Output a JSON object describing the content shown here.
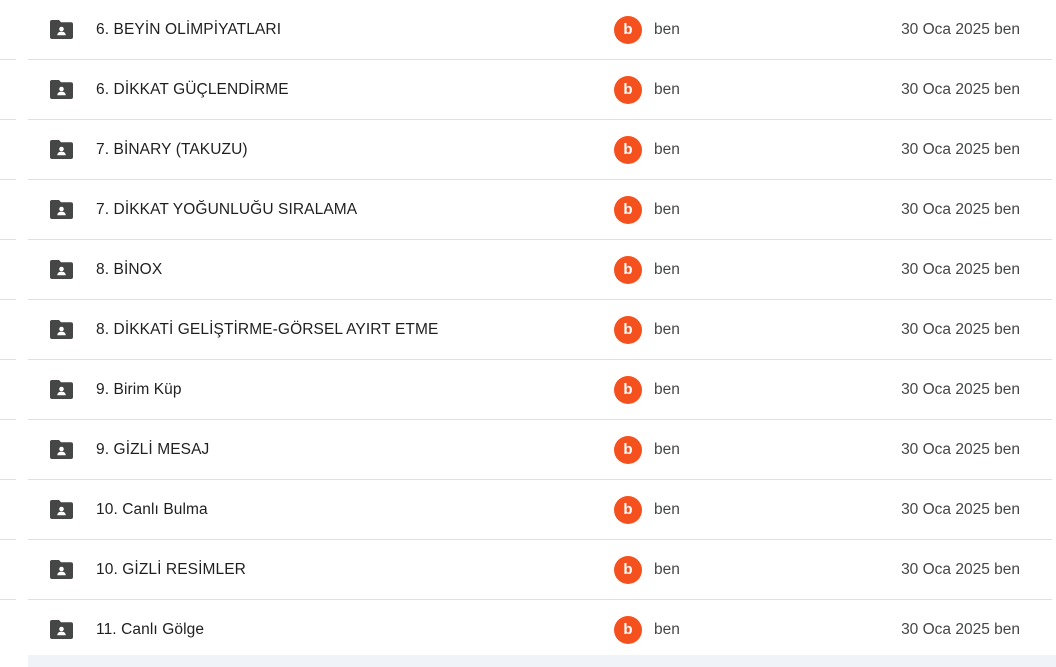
{
  "colors": {
    "avatar_bg": "#f4511e",
    "folder_icon": "#444746",
    "divider": "#e0e0e0"
  },
  "icons": {
    "folder": "shared-folder-icon"
  },
  "rows": [
    {
      "name": "6. BEYİN OLİMPİYATLARI",
      "avatar_letter": "b",
      "owner": "ben",
      "modified": "30 Oca 2025 ben"
    },
    {
      "name": "6. DİKKAT GÜÇLENDİRME",
      "avatar_letter": "b",
      "owner": "ben",
      "modified": "30 Oca 2025 ben"
    },
    {
      "name": "7. BİNARY (TAKUZU)",
      "avatar_letter": "b",
      "owner": "ben",
      "modified": "30 Oca 2025 ben"
    },
    {
      "name": "7. DİKKAT YOĞUNLUĞU SIRALAMA",
      "avatar_letter": "b",
      "owner": "ben",
      "modified": "30 Oca 2025 ben"
    },
    {
      "name": "8. BİNOX",
      "avatar_letter": "b",
      "owner": "ben",
      "modified": "30 Oca 2025 ben"
    },
    {
      "name": "8. DİKKATİ GELİŞTİRME-GÖRSEL AYIRT ETME",
      "avatar_letter": "b",
      "owner": "ben",
      "modified": "30 Oca 2025 ben"
    },
    {
      "name": "9. Birim Küp",
      "avatar_letter": "b",
      "owner": "ben",
      "modified": "30 Oca 2025 ben"
    },
    {
      "name": "9. GİZLİ MESAJ",
      "avatar_letter": "b",
      "owner": "ben",
      "modified": "30 Oca 2025 ben"
    },
    {
      "name": "10. Canlı Bulma",
      "avatar_letter": "b",
      "owner": "ben",
      "modified": "30 Oca 2025 ben"
    },
    {
      "name": "10. GİZLİ RESİMLER",
      "avatar_letter": "b",
      "owner": "ben",
      "modified": "30 Oca 2025 ben"
    },
    {
      "name": "11. Canlı Gölge",
      "avatar_letter": "b",
      "owner": "ben",
      "modified": "30 Oca 2025 ben"
    }
  ]
}
